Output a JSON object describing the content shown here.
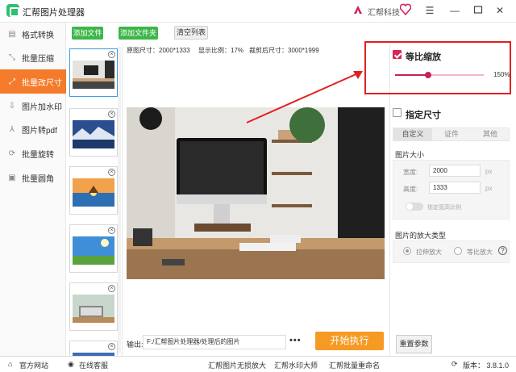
{
  "window": {
    "title": "汇帮图片处理器",
    "brand": "汇帮科技",
    "icons": [
      "brand-logo-icon",
      "heart-icon",
      "menu-icon",
      "minimize-icon",
      "maximize-icon",
      "close-icon"
    ]
  },
  "sidebar": {
    "items": [
      {
        "label": "格式转换",
        "icon": "format-convert-icon",
        "active": false
      },
      {
        "label": "批量压缩",
        "icon": "compress-icon",
        "active": false
      },
      {
        "label": "批量改尺寸",
        "icon": "resize-icon",
        "active": true
      },
      {
        "label": "图片加水印",
        "icon": "watermark-icon",
        "active": false
      },
      {
        "label": "图片转pdf",
        "icon": "pdf-icon",
        "active": false
      },
      {
        "label": "批量旋转",
        "icon": "rotate-icon",
        "active": false
      },
      {
        "label": "批量圆角",
        "icon": "rounded-corner-icon",
        "active": false
      }
    ]
  },
  "toolbar": {
    "add_file": "添加文件",
    "add_folder": "添加文件夹",
    "clear_list": "清空列表"
  },
  "info": {
    "original_size": "原图尺寸：2000*1333",
    "display_ratio": "显示比例：17%",
    "crop_size": "裁剪后尺寸：3000*1999"
  },
  "output": {
    "label": "输出:",
    "path": "F:/汇帮图片处理器/处理后的图片",
    "more": "•••",
    "start_button": "开始执行"
  },
  "right_panel": {
    "proportional_label": "等比缩放",
    "proportional_checked": true,
    "scale_value": "150%",
    "scale_fraction": 0.37,
    "custom_size_label": "指定尺寸",
    "custom_size_checked": false,
    "tabs": [
      "自定义",
      "证件",
      "其他"
    ],
    "active_tab": 0,
    "image_size_title": "图片大小",
    "width_label": "宽度:",
    "width_value": "2000",
    "height_label": "高度:",
    "height_value": "1333",
    "unit": "px",
    "lock_ratio_label": "锁定宽高比例",
    "enlarge_title": "图片的放大类型",
    "stretch_label": "拉伸放大",
    "proportional_enlarge_label": "等比放大",
    "help": "?",
    "reset_button": "重置参数"
  },
  "bottom_bar": {
    "website": "官方网站",
    "support": "在线客服",
    "lossless": "汇帮图片无损放大",
    "watermark_master": "汇帮水印大师",
    "batch_rename": "汇帮批量重命名",
    "version": "版本： 3.8.1.0"
  },
  "colors": {
    "accent_orange": "#f37b2b",
    "green_button": "#3db64a",
    "start_button": "#f59a23",
    "slider_pink": "#c8205a",
    "highlight_red": "#e02020"
  }
}
